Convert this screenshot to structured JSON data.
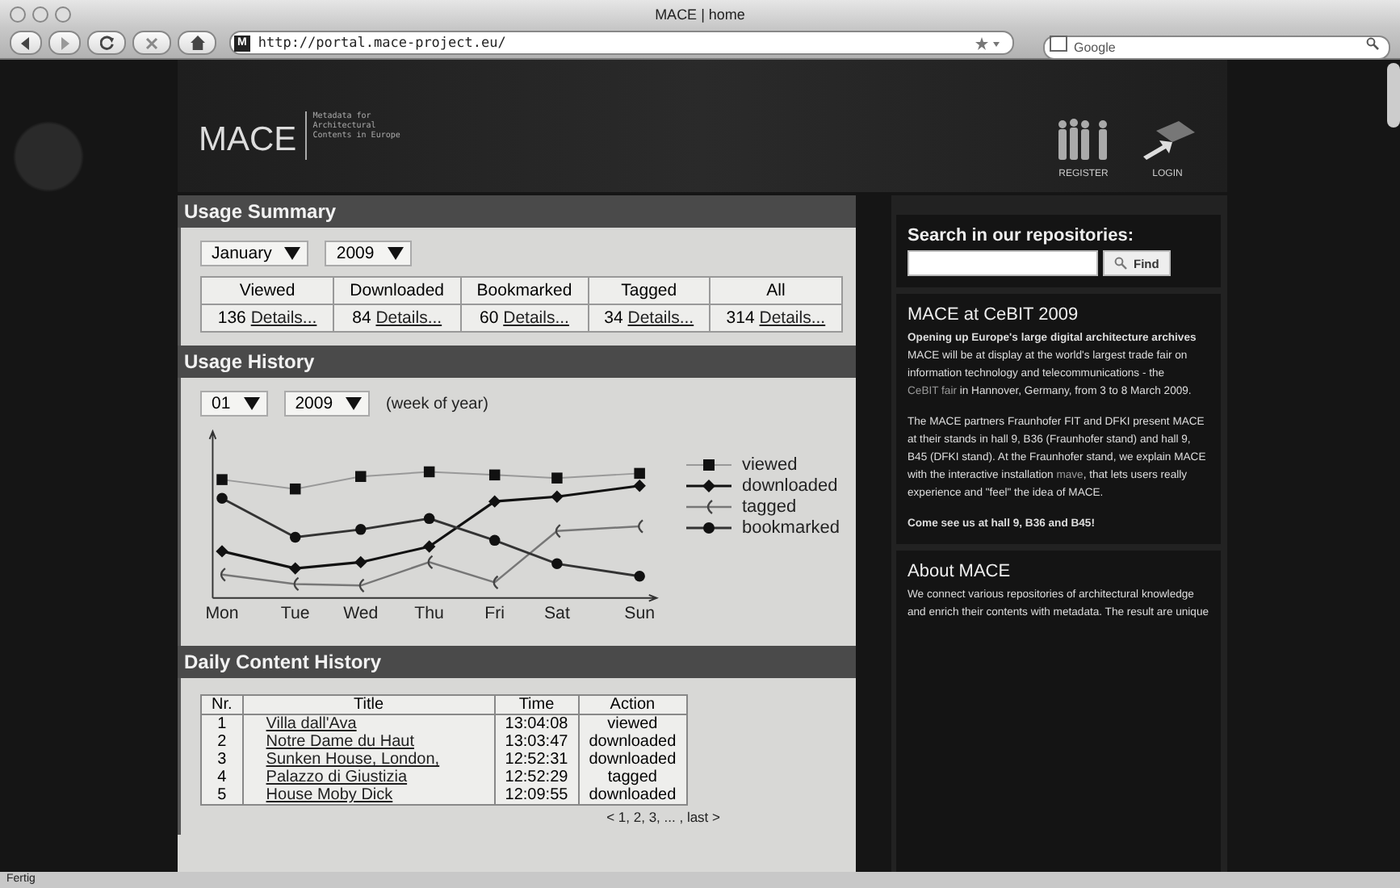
{
  "window": {
    "title": "MACE | home"
  },
  "toolbar": {
    "url": "http://portal.mace-project.eu/",
    "favicon": "M",
    "search_placeholder": "Google"
  },
  "header": {
    "logo": "MACE",
    "tagline": "Metadata for Architectural Contents in Europe",
    "links": [
      {
        "label": "REGISTER",
        "kind": "people"
      },
      {
        "label": "LOGIN",
        "kind": "arrow"
      }
    ]
  },
  "usage_summary": {
    "title": "Usage Summary",
    "month": "January",
    "year": "2009",
    "columns": [
      "Viewed",
      "Downloaded",
      "Bookmarked",
      "Tagged",
      "All"
    ],
    "cells": [
      {
        "count": "136",
        "link": "Details..."
      },
      {
        "count": "84",
        "link": "Details..."
      },
      {
        "count": "60",
        "link": "Details..."
      },
      {
        "count": "34",
        "link": "Details..."
      },
      {
        "count": "314",
        "link": "Details..."
      }
    ]
  },
  "usage_history": {
    "title": "Usage History",
    "week": "01",
    "year": "2009",
    "note": "(week of year)",
    "days": [
      "Mon",
      "Tue",
      "Wed",
      "Thu",
      "Fri",
      "Sat",
      "Sun"
    ],
    "legend": [
      {
        "label": "viewed",
        "kind": "square"
      },
      {
        "label": "downloaded",
        "kind": "diamond"
      },
      {
        "label": "tagged",
        "kind": "bracket"
      },
      {
        "label": "bookmarked",
        "kind": "circle"
      }
    ]
  },
  "daily_content": {
    "title": "Daily Content History",
    "columns": [
      "Nr.",
      "Title",
      "Time",
      "Action"
    ],
    "rows": [
      {
        "nr": "1",
        "title": "Villa dall'Ava",
        "time": "13:04:08",
        "action": "viewed"
      },
      {
        "nr": "2",
        "title": "Notre Dame du Haut",
        "time": "13:03:47",
        "action": "downloaded"
      },
      {
        "nr": "3",
        "title": "Sunken House, London,",
        "time": "12:52:31",
        "action": "downloaded"
      },
      {
        "nr": "4",
        "title": "Palazzo di Giustizia",
        "time": "12:52:29",
        "action": "tagged"
      },
      {
        "nr": "5",
        "title": "House Moby Dick",
        "time": "12:09:55",
        "action": "downloaded"
      }
    ],
    "pager": "< 1, 2, 3, ... , last >"
  },
  "search": {
    "title": "Search in our repositories:",
    "button": "Find"
  },
  "news": {
    "title": "MACE at CeBIT 2009",
    "lead": "Opening up Europe's large digital architecture archives",
    "paragraphs": [
      {
        "before": "MACE will be at display at the world's largest trade fair on information technology and telecommunications - the ",
        "link": "CeBIT fair",
        "after": " in Hannover, Germany, from 3 to 8 March 2009."
      },
      {
        "before": "The MACE partners Fraunhofer FIT and DFKI present MACE at their stands in hall 9, B36 (Fraunhofer stand) and hall 9, B45 (DFKI stand). At the Fraunhofer stand, we explain MACE with the interactive installation ",
        "link": "mave",
        "after": ", that lets users really experience and \"feel\" the idea of MACE."
      }
    ],
    "closing": "Come see us at hall 9, B36 and B45!"
  },
  "about": {
    "title": "About MACE",
    "text": "We connect various repositories of architectural knowledge and enrich their contents with metadata. The result are unique"
  },
  "status_bar": "Fertig"
}
